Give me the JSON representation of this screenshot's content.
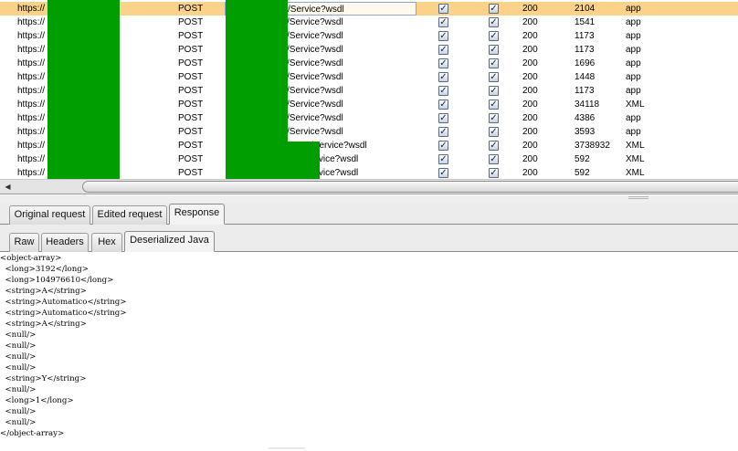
{
  "table": {
    "rows": [
      {
        "protocol": "https://",
        "method": "POST",
        "url": "/Service?wsdl",
        "check1": "✓",
        "check2": "✓",
        "status": "200",
        "length": "2104",
        "mime": "app",
        "selected": true
      },
      {
        "protocol": "https://",
        "method": "POST",
        "url": "/Service?wsdl",
        "check1": "✓",
        "check2": "✓",
        "status": "200",
        "length": "1541",
        "mime": "app"
      },
      {
        "protocol": "https://",
        "method": "POST",
        "url": "/Service?wsdl",
        "check1": "✓",
        "check2": "✓",
        "status": "200",
        "length": "1173",
        "mime": "app"
      },
      {
        "protocol": "https://",
        "method": "POST",
        "url": "/Service?wsdl",
        "check1": "✓",
        "check2": "✓",
        "status": "200",
        "length": "1173",
        "mime": "app"
      },
      {
        "protocol": "https://",
        "method": "POST",
        "url": "/Service?wsdl",
        "check1": "✓",
        "check2": "✓",
        "status": "200",
        "length": "1696",
        "mime": "app"
      },
      {
        "protocol": "https://",
        "method": "POST",
        "url": "/Service?wsdl",
        "check1": "✓",
        "check2": "✓",
        "status": "200",
        "length": "1448",
        "mime": "app"
      },
      {
        "protocol": "https://",
        "method": "POST",
        "url": "/Service?wsdl",
        "check1": "✓",
        "check2": "✓",
        "status": "200",
        "length": "1173",
        "mime": "app"
      },
      {
        "protocol": "https://",
        "method": "POST",
        "url": "/Service?wsdl",
        "check1": "✓",
        "check2": "✓",
        "status": "200",
        "length": "34118",
        "mime": "XML"
      },
      {
        "protocol": "https://",
        "method": "POST",
        "url": "/Service?wsdl",
        "check1": "✓",
        "check2": "✓",
        "status": "200",
        "length": "4386",
        "mime": "app"
      },
      {
        "protocol": "https://",
        "method": "POST",
        "url": "/Service?wsdl",
        "check1": "✓",
        "check2": "✓",
        "status": "200",
        "length": "3593",
        "mime": "app"
      },
      {
        "protocol": "https://",
        "method": "POST",
        "url": "/Service?wsdl",
        "check1": "✓",
        "check2": "✓",
        "status": "200",
        "length": "3738932",
        "mime": "XML",
        "url_offset": true
      },
      {
        "protocol": "https://",
        "method": "POST",
        "url": "ervice?wsdl",
        "check1": "✓",
        "check2": "✓",
        "status": "200",
        "length": "592",
        "mime": "XML",
        "url_offset": true
      },
      {
        "protocol": "https://",
        "method": "POST",
        "url": "ervice?wsdl",
        "check1": "✓",
        "check2": "✓",
        "status": "200",
        "length": "592",
        "mime": "XML",
        "url_offset": true
      }
    ]
  },
  "scrollbar": {
    "left_arrow": "◀"
  },
  "tabs_request": {
    "items": [
      {
        "label": "Original request",
        "active": false
      },
      {
        "label": "Edited request",
        "active": false
      },
      {
        "label": "Response",
        "active": true
      }
    ]
  },
  "tabs_view": {
    "items": [
      {
        "label": "Raw",
        "active": false
      },
      {
        "label": "Headers",
        "active": false
      },
      {
        "label": "Hex",
        "active": false
      },
      {
        "label": "Deserialized Java",
        "active": true
      }
    ]
  },
  "response": {
    "lines": [
      "<object-array>",
      "  <long>3192</long>",
      "  <long>104976610</long>",
      "  <string>A</string>",
      "  <string>Automatico</string>",
      "  <string>Automatico</string>",
      "  <string>A</string>",
      "  <null/>",
      "  <null/>",
      "  <null/>",
      "  <null/>",
      "  <string>Y</string>",
      "  <null/>",
      "  <long>1</long>",
      "  <null/>",
      "  <null/>",
      "</object-array>"
    ]
  },
  "colors": {
    "selected_row": "#fbd28a",
    "redaction": "#009e00"
  }
}
